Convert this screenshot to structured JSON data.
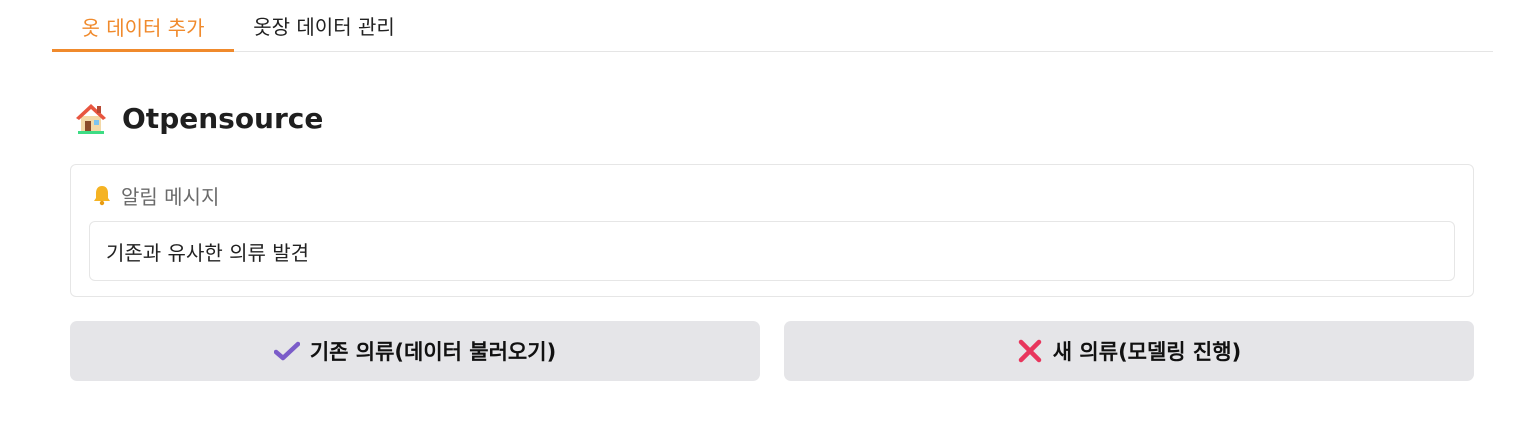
{
  "tabs": [
    {
      "label": "옷 데이터 추가",
      "active": true
    },
    {
      "label": "옷장 데이터 관리",
      "active": false
    }
  ],
  "header": {
    "icon": "house-icon",
    "title": "Otpensource"
  },
  "notification": {
    "icon": "bell-icon",
    "label": "알림 메시지",
    "message": "기존과 유사한 의류 발견"
  },
  "actions": {
    "existing": {
      "icon": "check-icon",
      "label": "기존 의류(데이터 불러오기)"
    },
    "new": {
      "icon": "cross-icon",
      "label": "새 의류(모델링 진행)"
    }
  },
  "colors": {
    "accent": "#f08a2c",
    "button_bg": "#e5e5e8",
    "check": "#7b5cc9",
    "cross": "#e8365d"
  }
}
